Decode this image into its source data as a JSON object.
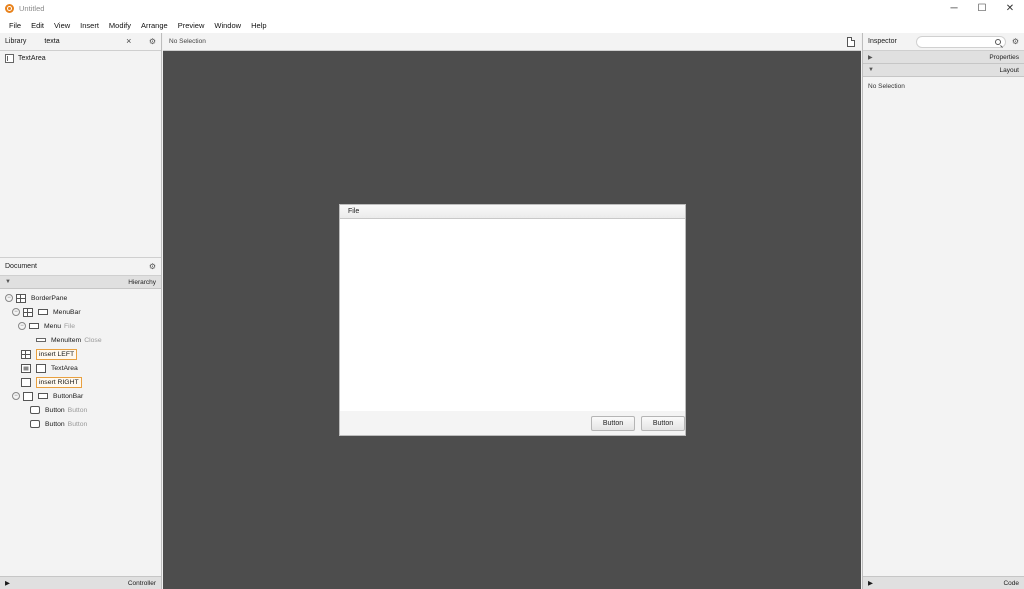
{
  "window": {
    "title": "Untitled",
    "minimize_glyph": "─",
    "maximize_glyph": "☐",
    "close_glyph": "✕"
  },
  "menu": [
    "File",
    "Edit",
    "View",
    "Insert",
    "Modify",
    "Arrange",
    "Preview",
    "Window",
    "Help"
  ],
  "library": {
    "title": "Library",
    "search_value": "texta",
    "gear_glyph": "⚙",
    "items": [
      {
        "label": "TextArea",
        "icon": "textarea-icon"
      }
    ]
  },
  "document": {
    "title": "Document",
    "hierarchy_label": "Hierarchy",
    "controller_label": "Controller",
    "tree": [
      {
        "label": "BorderPane",
        "hint": "",
        "icon": "borderpane-icon"
      },
      {
        "label": "MenuBar",
        "hint": "",
        "icon": "menubar-icon"
      },
      {
        "label": "Menu",
        "hint": "File",
        "icon": "menu-icon"
      },
      {
        "label": "MenuItem",
        "hint": "Close",
        "icon": "menuitem-icon"
      },
      {
        "label": "insert LEFT",
        "hint": "",
        "icon": "insert-left-icon"
      },
      {
        "label": "TextArea",
        "hint": "",
        "icon": "textarea-icon"
      },
      {
        "label": "insert RIGHT",
        "hint": "",
        "icon": "insert-right-icon"
      },
      {
        "label": "ButtonBar",
        "hint": "",
        "icon": "buttonbar-icon"
      },
      {
        "label": "Button",
        "hint": "Button",
        "icon": "button-icon"
      },
      {
        "label": "Button",
        "hint": "Button",
        "icon": "button-icon"
      }
    ]
  },
  "canvas": {
    "selection_status": "No Selection",
    "preview": {
      "menu_label": "File",
      "buttons": [
        "Button",
        "Button"
      ]
    }
  },
  "inspector": {
    "title": "Inspector",
    "properties_label": "Properties",
    "layout_label": "Layout",
    "no_selection": "No Selection",
    "code_label": "Code"
  },
  "colors": {
    "canvas_bg": "#4d4d4d",
    "accent": "#e8821c",
    "insert_border": "#e8a040"
  }
}
